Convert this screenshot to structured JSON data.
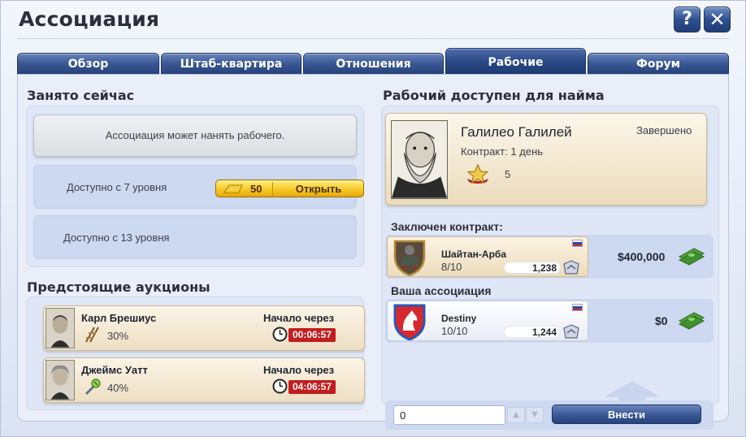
{
  "window": {
    "title": "Ассоциация",
    "help_label": "?",
    "close_label": "✕"
  },
  "tabs": [
    {
      "label": "Обзор",
      "active": false
    },
    {
      "label": "Штаб-квартира",
      "active": false
    },
    {
      "label": "Отношения",
      "active": false
    },
    {
      "label": "Рабочие",
      "active": true
    },
    {
      "label": "Форум",
      "active": false
    }
  ],
  "busy": {
    "title": "Занято сейчас",
    "hire_message": "Ассоциация может нанять рабочего.",
    "slot_level7": "Доступно с 7 уровня",
    "open_cost": "50",
    "open_label": "Открыть",
    "slot_level13": "Доступно с 13 уровня"
  },
  "auctions": {
    "title": "Предстоящие аукционы",
    "items": [
      {
        "name": "Карл Брешиус",
        "percent": "30%",
        "start_label": "Начало через",
        "timer": "00:06:57",
        "perk_icon": "rails-icon"
      },
      {
        "name": "Джеймс Уатт",
        "percent": "40%",
        "start_label": "Начало через",
        "timer": "04:06:57",
        "perk_icon": "wrench-icon"
      }
    ]
  },
  "worker": {
    "title": "Рабочий доступен для найма",
    "name": "Галилео Галилей",
    "contract": "Контракт: 1 день",
    "status": "Завершено",
    "level": "5"
  },
  "contracted": {
    "title": "Заключен контракт:",
    "name": "Шайтан-Арба",
    "members": "8/10",
    "score": "1,238",
    "money": "$400,000"
  },
  "your_assoc": {
    "title": "Ваша ассоциация",
    "name": "Destiny",
    "members": "10/10",
    "score": "1,244",
    "money": "$0"
  },
  "deposit": {
    "value": "0",
    "button_label": "Внести"
  },
  "colors": {
    "tab_blue": "#2c4a86",
    "gold": "#f7c928",
    "timer_red": "#c41d1d"
  }
}
